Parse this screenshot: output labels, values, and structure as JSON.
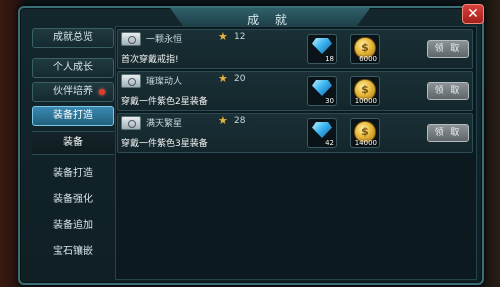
{
  "window": {
    "title": "成 就",
    "close_glyph": "✕"
  },
  "sidebar": {
    "tabs": [
      {
        "label": "成就总览",
        "active": false,
        "red_dot": false
      },
      {
        "label": "个人成长",
        "active": false,
        "red_dot": false
      },
      {
        "label": "伙伴培养",
        "active": false,
        "red_dot": true
      },
      {
        "label": "装备打造",
        "active": true,
        "red_dot": false
      }
    ],
    "subitems": [
      {
        "label": "装备",
        "active": true
      },
      {
        "label": "装备打造",
        "active": false
      },
      {
        "label": "装备强化",
        "active": false
      },
      {
        "label": "装备追加",
        "active": false
      },
      {
        "label": "宝石镶嵌",
        "active": false
      }
    ]
  },
  "achievements": [
    {
      "name": "一颗永恒",
      "points": "12",
      "description": "首次穿戴戒指!",
      "rewards": [
        {
          "type": "gem",
          "icon": "diamond-icon",
          "count": "18"
        },
        {
          "type": "coin",
          "icon": "gold-coin-icon",
          "count": "6000"
        }
      ],
      "claim_label": "领 取"
    },
    {
      "name": "璀璨动人",
      "points": "20",
      "description": "穿戴一件紫色2星装备",
      "rewards": [
        {
          "type": "gem",
          "icon": "diamond-icon",
          "count": "30"
        },
        {
          "type": "coin",
          "icon": "gold-coin-icon",
          "count": "10000"
        }
      ],
      "claim_label": "领 取"
    },
    {
      "name": "满天繁星",
      "points": "28",
      "description": "穿戴一件紫色3星装备",
      "rewards": [
        {
          "type": "gem",
          "icon": "diamond-icon",
          "count": "42"
        },
        {
          "type": "coin",
          "icon": "gold-coin-icon",
          "count": "14000"
        }
      ],
      "claim_label": "领 取"
    }
  ],
  "colors": {
    "accent_active_tab": "#2f78a0",
    "star": "#e6b43c",
    "red_dot": "#e53b2b"
  }
}
